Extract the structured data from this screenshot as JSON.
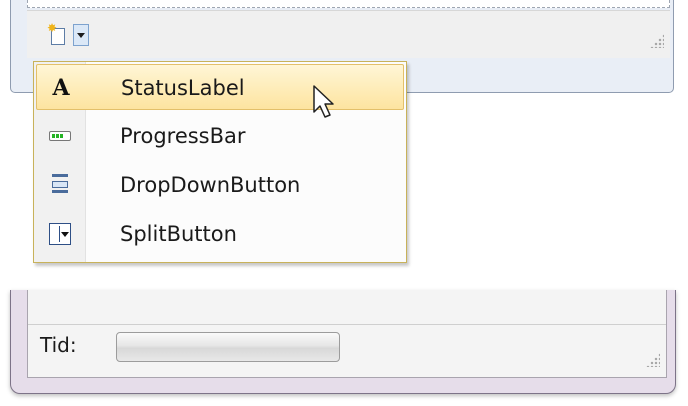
{
  "menu": {
    "items": [
      {
        "label": "StatusLabel",
        "icon": "status-label-icon",
        "hovered": true
      },
      {
        "label": "ProgressBar",
        "icon": "progress-bar-icon",
        "hovered": false
      },
      {
        "label": "DropDownButton",
        "icon": "dropdown-button-icon",
        "hovered": false
      },
      {
        "label": "SplitButton",
        "icon": "split-button-icon",
        "hovered": false
      }
    ],
    "hover_color": "#fde4a0"
  },
  "top_form": {
    "add_button_icon": "new-item-icon",
    "dropdown_icon": "chevron-down-icon"
  },
  "bottom_form": {
    "status_label": "Tid:",
    "progress": 0
  },
  "colors": {
    "menu_border": "#c8b25a",
    "form_frame": "#e6ddea"
  }
}
